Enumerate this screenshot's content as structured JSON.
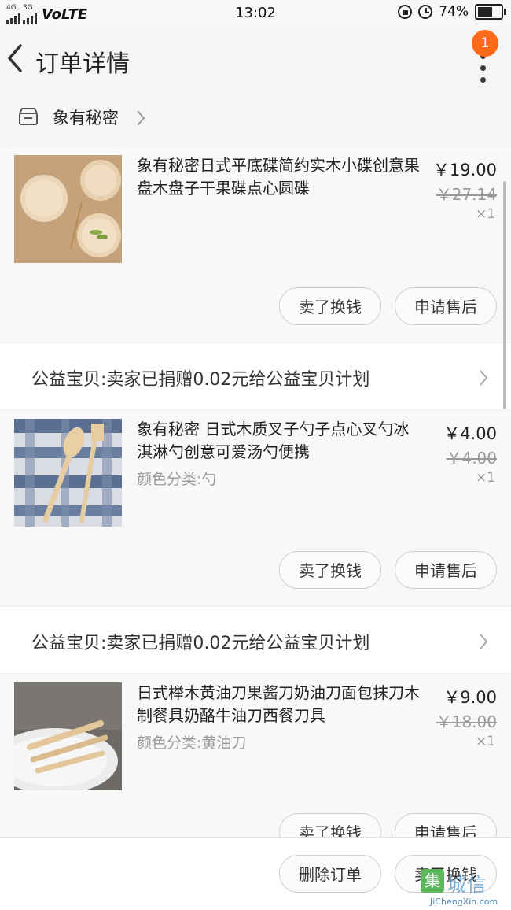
{
  "status_bar": {
    "network_top": "4G",
    "network_bottom": "3G",
    "carrier_mode": "VoLTE",
    "time": "13:02",
    "battery": "74%",
    "battery_level": 0.74,
    "icons": [
      "signal-icon",
      "rotation-lock-icon",
      "alarm-icon",
      "battery-icon"
    ]
  },
  "header": {
    "title": "订单详情",
    "notification_count": "1",
    "icons": [
      "back-arrow-icon",
      "more-vertical-icon"
    ]
  },
  "shop": {
    "name": "象有秘密",
    "icons": [
      "store-icon",
      "chevron-right-icon"
    ]
  },
  "items": [
    {
      "name": "象有秘密日式平底碟简约实木小碟创意果盘木盘子干果碟点心圆碟",
      "variant": "",
      "price": "￥19.00",
      "original_price": "￥27.14",
      "quantity": "×1",
      "buttons": {
        "sell": "卖了换钱",
        "after_sale": "申请售后"
      },
      "image": "wooden-plates-photo"
    },
    {
      "name": "象有秘密 日式木质叉子勺子点心叉勺冰淇淋勺创意可爱汤勺便携",
      "variant": "颜色分类:勺",
      "price": "￥4.00",
      "original_price": "￥4.00",
      "quantity": "×1",
      "buttons": {
        "sell": "卖了换钱",
        "after_sale": "申请售后"
      },
      "image": "wooden-spoon-fork-photo"
    },
    {
      "name": "日式榉木黄油刀果酱刀奶油刀面包抹刀木制餐具奶酪牛油刀西餐刀具",
      "variant": "颜色分类:黄油刀",
      "price": "￥9.00",
      "original_price": "￥18.00",
      "quantity": "×1",
      "buttons": {
        "sell": "卖了换钱",
        "after_sale": "申请售后"
      },
      "image": "butter-knife-photo"
    }
  ],
  "donation_notes": [
    "公益宝贝:卖家已捐赠0.02元给公益宝贝计划",
    "公益宝贝:卖家已捐赠0.02元给公益宝贝计划"
  ],
  "footer": {
    "delete_order": "删除订单",
    "sell": "卖了换钱"
  },
  "watermark": {
    "cn": "城信",
    "en": "JiChengXin.com"
  },
  "colors": {
    "badge": "#ff6a1a",
    "background": "#f2f2f2",
    "muted_text": "#999999"
  }
}
